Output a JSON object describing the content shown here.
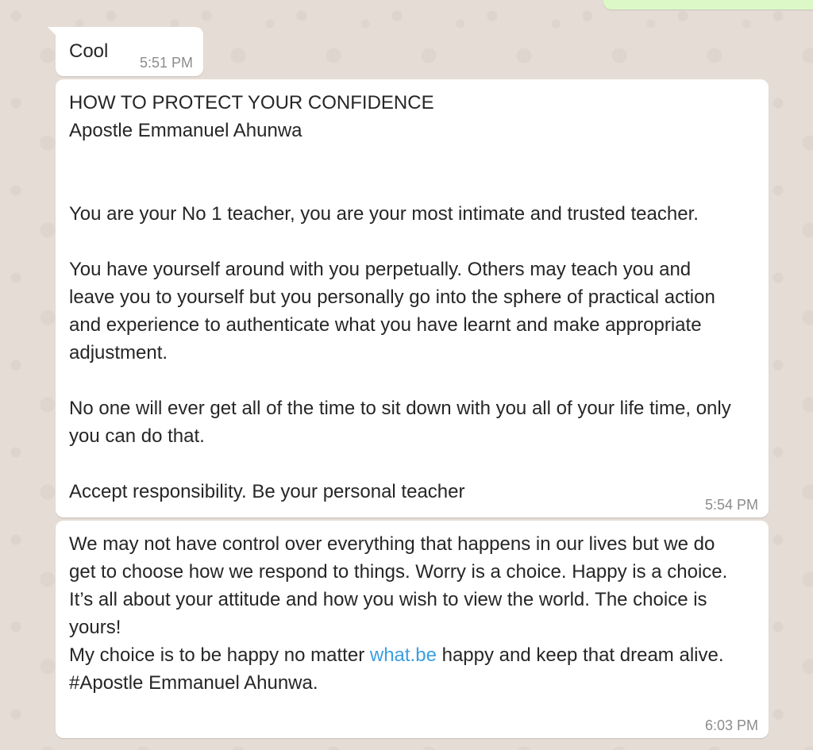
{
  "messages": {
    "cool": {
      "text": "Cool",
      "time": "5:51 PM"
    },
    "confidence": {
      "title": "HOW TO PROTECT YOUR CONFIDENCE",
      "author": "Apostle Emmanuel Ahunwa",
      "para1": "You are your No 1 teacher, you are your most intimate and trusted teacher.",
      "para2": "You have yourself around with you perpetually. Others may teach you and leave you to yourself but you personally go into the sphere of practical action and experience to authenticate what you have learnt and make appropriate adjustment.",
      "para3": "No one will ever get all of the time to sit down with you all of your life time, only you can do that.",
      "para4": "Accept responsibility. Be your personal teacher",
      "time": "5:54 PM"
    },
    "choice": {
      "para1": "We may not have control over everything that happens in our lives but we do get to choose how we respond to things. Worry is a choice. Happy is a choice. It’s all about your attitude and how you wish to view the world. The choice is yours!",
      "line2_before": "My choice is to be happy no matter ",
      "line2_link": "what.be",
      "line2_after": " happy and keep that dream alive.",
      "signature": "#Apostle Emmanuel Ahunwa.",
      "time": "6:03 PM"
    }
  },
  "colors": {
    "chat_background": "#e5ddd5",
    "incoming_bubble": "#ffffff",
    "outgoing_bubble": "#dcf8c6",
    "link": "#3a9fe0",
    "timestamp": "#8c8c8c"
  }
}
